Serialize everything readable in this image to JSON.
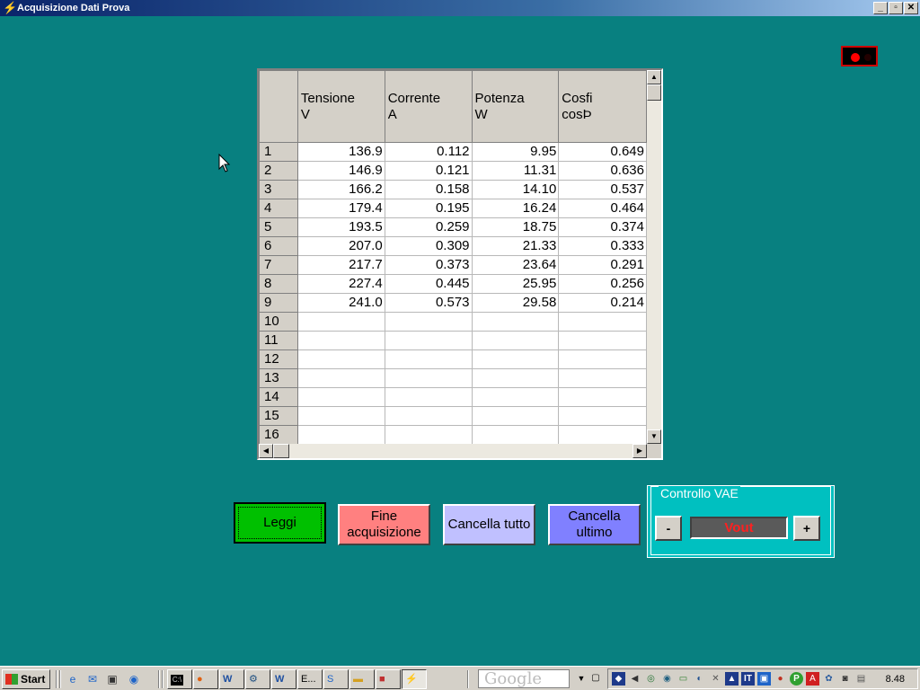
{
  "window": {
    "title": "Acquisizione Dati Prova",
    "minimize": "_",
    "restore": "▫",
    "close": "✕"
  },
  "table": {
    "columns": [
      {
        "line1": "Tensione",
        "line2": "V"
      },
      {
        "line1": "Corrente",
        "line2": "A"
      },
      {
        "line1": "Potenza",
        "line2": "W"
      },
      {
        "line1": "Cosfi",
        "line2": "cosÞ"
      }
    ],
    "rows": [
      {
        "n": "1",
        "v": "136.9",
        "a": "0.112",
        "w": "9.95",
        "c": "0.649"
      },
      {
        "n": "2",
        "v": "146.9",
        "a": "0.121",
        "w": "11.31",
        "c": "0.636"
      },
      {
        "n": "3",
        "v": "166.2",
        "a": "0.158",
        "w": "14.10",
        "c": "0.537"
      },
      {
        "n": "4",
        "v": "179.4",
        "a": "0.195",
        "w": "16.24",
        "c": "0.464"
      },
      {
        "n": "5",
        "v": "193.5",
        "a": "0.259",
        "w": "18.75",
        "c": "0.374"
      },
      {
        "n": "6",
        "v": "207.0",
        "a": "0.309",
        "w": "21.33",
        "c": "0.333"
      },
      {
        "n": "7",
        "v": "217.7",
        "a": "0.373",
        "w": "23.64",
        "c": "0.291"
      },
      {
        "n": "8",
        "v": "227.4",
        "a": "0.445",
        "w": "25.95",
        "c": "0.256"
      },
      {
        "n": "9",
        "v": "241.0",
        "a": "0.573",
        "w": "29.58",
        "c": "0.214"
      },
      {
        "n": "10",
        "v": "",
        "a": "",
        "w": "",
        "c": ""
      },
      {
        "n": "11",
        "v": "",
        "a": "",
        "w": "",
        "c": ""
      },
      {
        "n": "12",
        "v": "",
        "a": "",
        "w": "",
        "c": ""
      },
      {
        "n": "13",
        "v": "",
        "a": "",
        "w": "",
        "c": ""
      },
      {
        "n": "14",
        "v": "",
        "a": "",
        "w": "",
        "c": ""
      },
      {
        "n": "15",
        "v": "",
        "a": "",
        "w": "",
        "c": ""
      },
      {
        "n": "16",
        "v": "",
        "a": "",
        "w": "",
        "c": ""
      }
    ]
  },
  "buttons": {
    "leggi": "Leggi",
    "fine_line1": "Fine",
    "fine_line2": "acquisizione",
    "cancella_tutto": "Cancella tutto",
    "cancella_ultimo_line1": "Cancella",
    "cancella_ultimo_line2": "ultimo"
  },
  "vae": {
    "legend": "Controllo VAE",
    "minus": "-",
    "plus": "+",
    "display": "Vout"
  },
  "taskbar": {
    "start": "Start",
    "task_e": "E...",
    "search_placeholder": "Google",
    "clock": "8.48"
  },
  "colors": {
    "desktop": "#088080",
    "leggi": "#00c000",
    "fine": "#ff8080",
    "cancella_tutto": "#c0c0ff",
    "cancella_ultimo": "#8080ff",
    "vae_panel": "#00c0c0",
    "vout_text": "#ff2020"
  }
}
